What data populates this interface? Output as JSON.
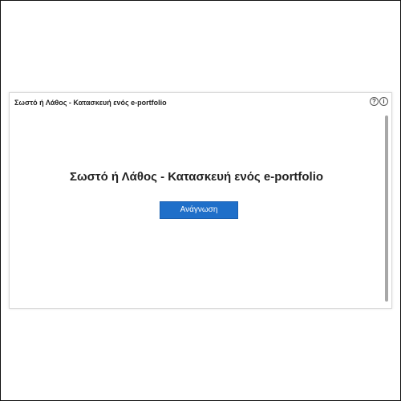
{
  "widget": {
    "header_title": "Σωστό ή Λάθος - Κατασκευή ενός e-portfolio",
    "help_icon_glyph": "?",
    "info_icon_glyph": "i",
    "main_title": "Σωστό ή Λάθος - Κατασκευή ενός e-portfolio",
    "read_button_label": "Ανάγνωση",
    "accent_color": "#1f6fc9"
  }
}
